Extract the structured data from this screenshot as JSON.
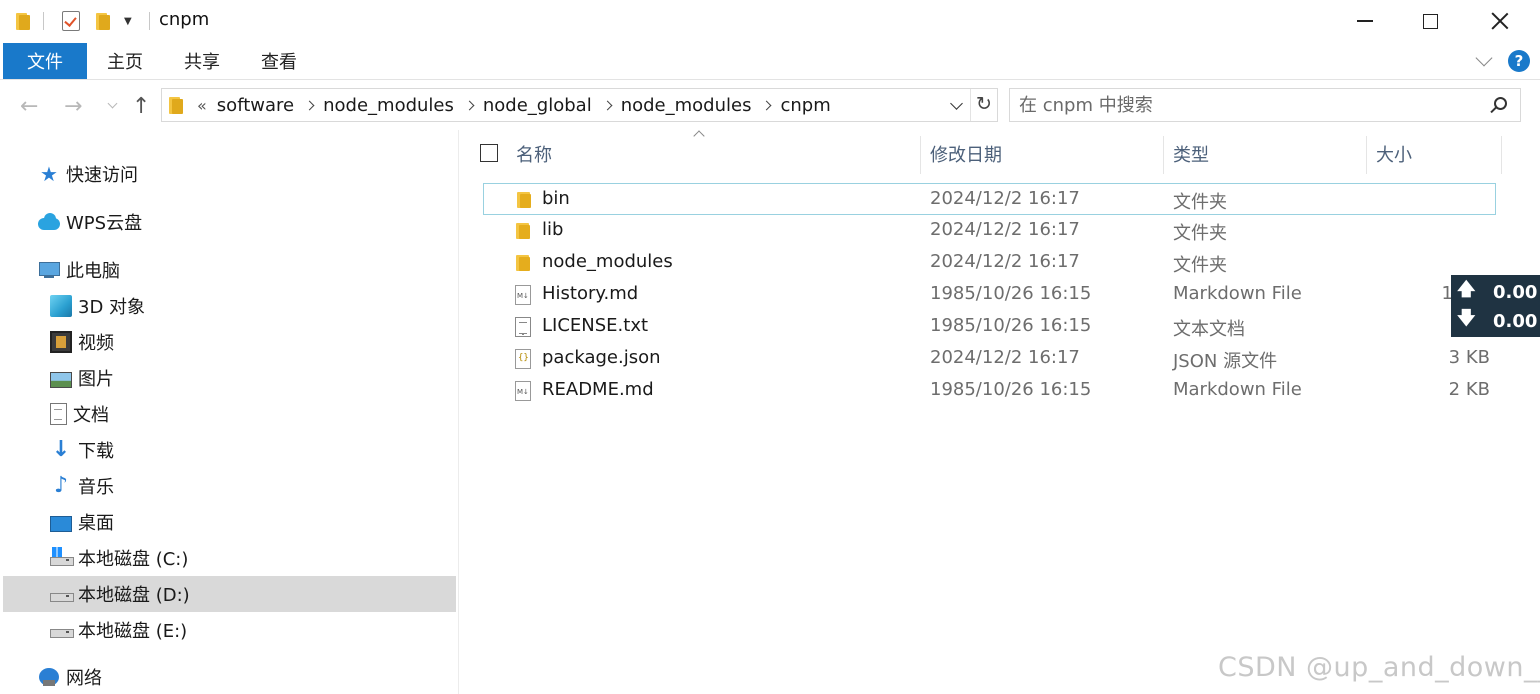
{
  "window": {
    "title": "cnpm"
  },
  "ribbon": {
    "tabs": [
      "文件",
      "主页",
      "共享",
      "查看"
    ],
    "help_label": "?"
  },
  "address": {
    "more": "«",
    "crumbs": [
      "software",
      "node_modules",
      "node_global",
      "node_modules",
      "cnpm"
    ],
    "search_placeholder": "在 cnpm 中搜索"
  },
  "sidebar": {
    "items": [
      {
        "label": "快速访问",
        "icon": "star-icon"
      },
      {
        "label": "WPS云盘",
        "icon": "cloud-icon"
      },
      {
        "label": "此电脑",
        "icon": "computer-icon"
      },
      {
        "label": "3D 对象",
        "icon": "cube-3d-icon"
      },
      {
        "label": "视频",
        "icon": "video-icon"
      },
      {
        "label": "图片",
        "icon": "picture-icon"
      },
      {
        "label": "文档",
        "icon": "document-icon"
      },
      {
        "label": "下载",
        "icon": "download-icon"
      },
      {
        "label": "音乐",
        "icon": "music-icon"
      },
      {
        "label": "桌面",
        "icon": "desktop-icon"
      },
      {
        "label": "本地磁盘 (C:)",
        "icon": "drive-c-icon"
      },
      {
        "label": "本地磁盘 (D:)",
        "icon": "drive-icon",
        "selected": true
      },
      {
        "label": "本地磁盘 (E:)",
        "icon": "drive-icon"
      },
      {
        "label": "网络",
        "icon": "network-icon"
      }
    ]
  },
  "columns": {
    "name": "名称",
    "date": "修改日期",
    "type": "类型",
    "size": "大小"
  },
  "files": [
    {
      "name": "bin",
      "date": "2024/12/2 16:17",
      "type": "文件夹",
      "size": "",
      "icon": "folder-icon"
    },
    {
      "name": "lib",
      "date": "2024/12/2 16:17",
      "type": "文件夹",
      "size": "",
      "icon": "folder-icon"
    },
    {
      "name": "node_modules",
      "date": "2024/12/2 16:17",
      "type": "文件夹",
      "size": "",
      "icon": "folder-icon"
    },
    {
      "name": "History.md",
      "date": "1985/10/26 16:15",
      "type": "Markdown File",
      "size": "1",
      "icon": "markdown-file-icon"
    },
    {
      "name": "LICENSE.txt",
      "date": "1985/10/26 16:15",
      "type": "文本文档",
      "size": "",
      "icon": "text-file-icon"
    },
    {
      "name": "package.json",
      "date": "2024/12/2 16:17",
      "type": "JSON 源文件",
      "size": "3 KB",
      "icon": "json-file-icon"
    },
    {
      "name": "README.md",
      "date": "1985/10/26 16:15",
      "type": "Markdown File",
      "size": "2 KB",
      "icon": "markdown-file-icon"
    }
  ],
  "net_speed": {
    "up": "0.00",
    "down": "0.00"
  },
  "watermark": "CSDN @up_and_down__"
}
